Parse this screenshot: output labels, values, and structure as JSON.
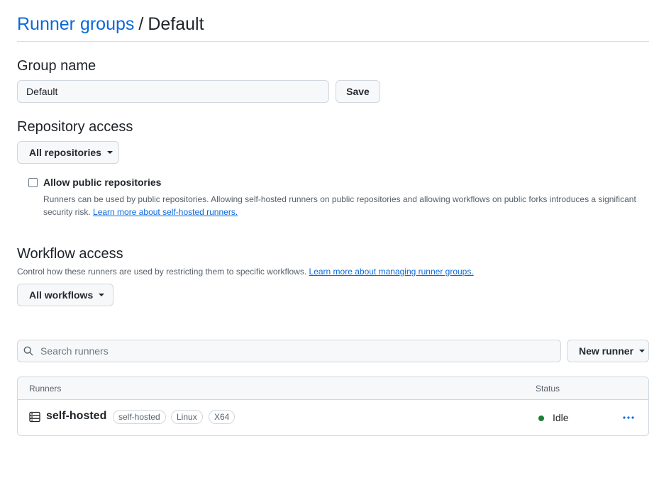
{
  "breadcrumb": {
    "parent": "Runner groups",
    "separator": "/",
    "current": "Default"
  },
  "group_name": {
    "heading": "Group name",
    "value": "Default",
    "save_label": "Save"
  },
  "repository_access": {
    "heading": "Repository access",
    "dropdown_label": "All repositories",
    "allow_public_label": "Allow public repositories",
    "allow_public_checked": false,
    "description": "Runners can be used by public repositories. Allowing self-hosted runners on public repositories and allowing workflows on public forks introduces a significant security risk.",
    "learn_more": "Learn more about self-hosted runners."
  },
  "workflow_access": {
    "heading": "Workflow access",
    "description": "Control how these runners are used by restricting them to specific workflows.",
    "learn_more": "Learn more about managing runner groups.",
    "dropdown_label": "All workflows"
  },
  "search": {
    "placeholder": "Search runners",
    "icon": "search-icon"
  },
  "new_runner_label": "New runner",
  "table": {
    "columns": [
      "Runners",
      "Status"
    ],
    "rows": [
      {
        "icon": "server-icon",
        "name": "self-hosted",
        "labels": [
          "self-hosted",
          "Linux",
          "X64"
        ],
        "status": "Idle",
        "status_color": "#1a7f37",
        "actions_icon": "kebab-horizontal-icon"
      }
    ]
  },
  "colors": {
    "accent": "#0969da",
    "border": "#d0d7de",
    "muted": "#57606a",
    "success": "#1a7f37"
  }
}
